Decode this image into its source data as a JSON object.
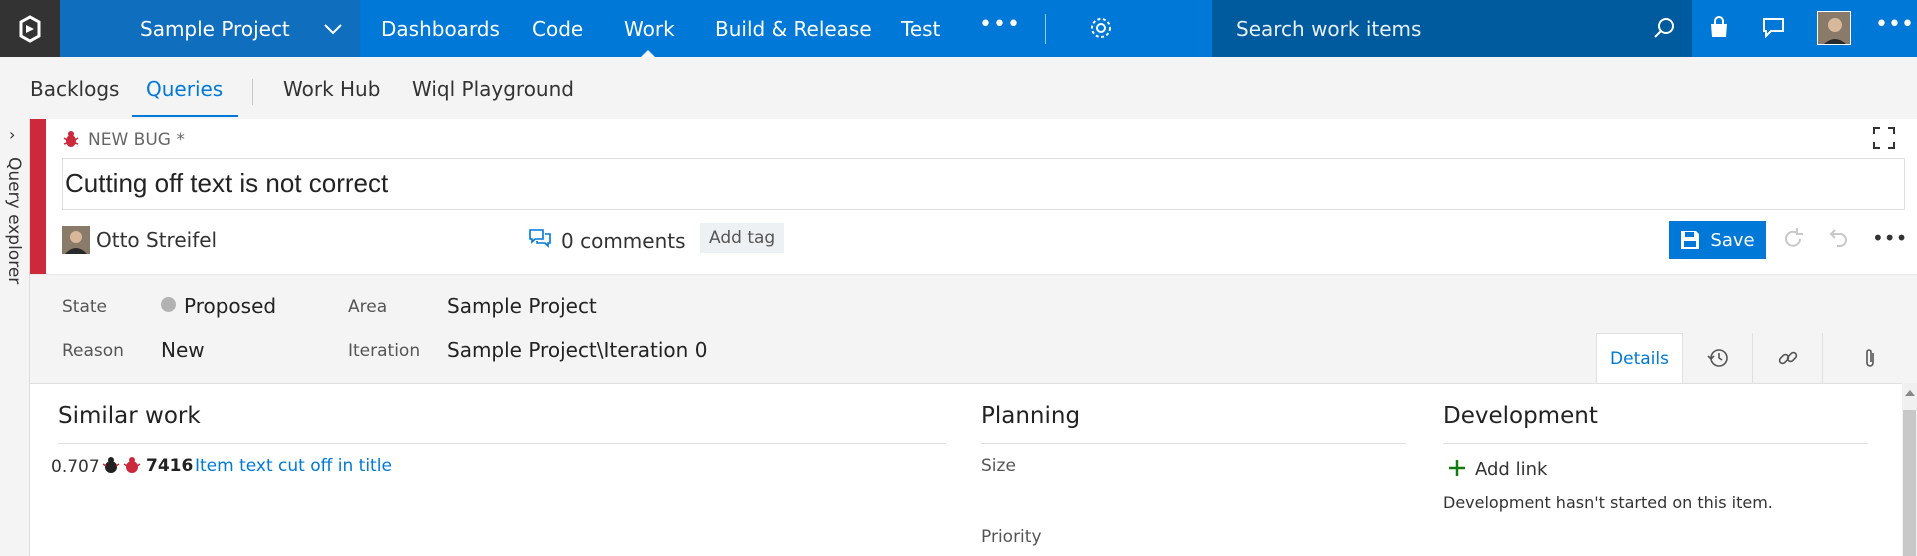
{
  "topbar": {
    "project": "Sample Project",
    "nav": [
      "Dashboards",
      "Code",
      "Work",
      "Build & Release",
      "Test"
    ],
    "active_nav": "Work",
    "search_placeholder": "Search work items",
    "accent_color": "#0078d7"
  },
  "subnav": {
    "items": [
      "Backlogs",
      "Queries",
      "Work Hub",
      "Wiql Playground"
    ],
    "active": "Queries"
  },
  "rail": {
    "label": "Query explorer"
  },
  "work_item": {
    "type_label": "NEW BUG *",
    "title": "Cutting off text is not correct",
    "assignee": "Otto Streifel",
    "comments": "0 comments",
    "add_tag": "Add tag",
    "save_label": "Save",
    "type_color": "#cc293d"
  },
  "fields": {
    "state_label": "State",
    "state_value": "Proposed",
    "reason_label": "Reason",
    "reason_value": "New",
    "area_label": "Area",
    "area_value": "Sample Project",
    "iteration_label": "Iteration",
    "iteration_value": "Sample Project\\Iteration 0"
  },
  "tabs": {
    "details": "Details"
  },
  "sections": {
    "similar_work": {
      "title": "Similar work",
      "items": [
        {
          "score": "0.707",
          "id": "7416",
          "title": "Item text cut off in title"
        }
      ]
    },
    "planning": {
      "title": "Planning",
      "fields": [
        "Size",
        "Priority"
      ]
    },
    "development": {
      "title": "Development",
      "add_link": "Add link",
      "note": "Development hasn't started on this item."
    }
  }
}
